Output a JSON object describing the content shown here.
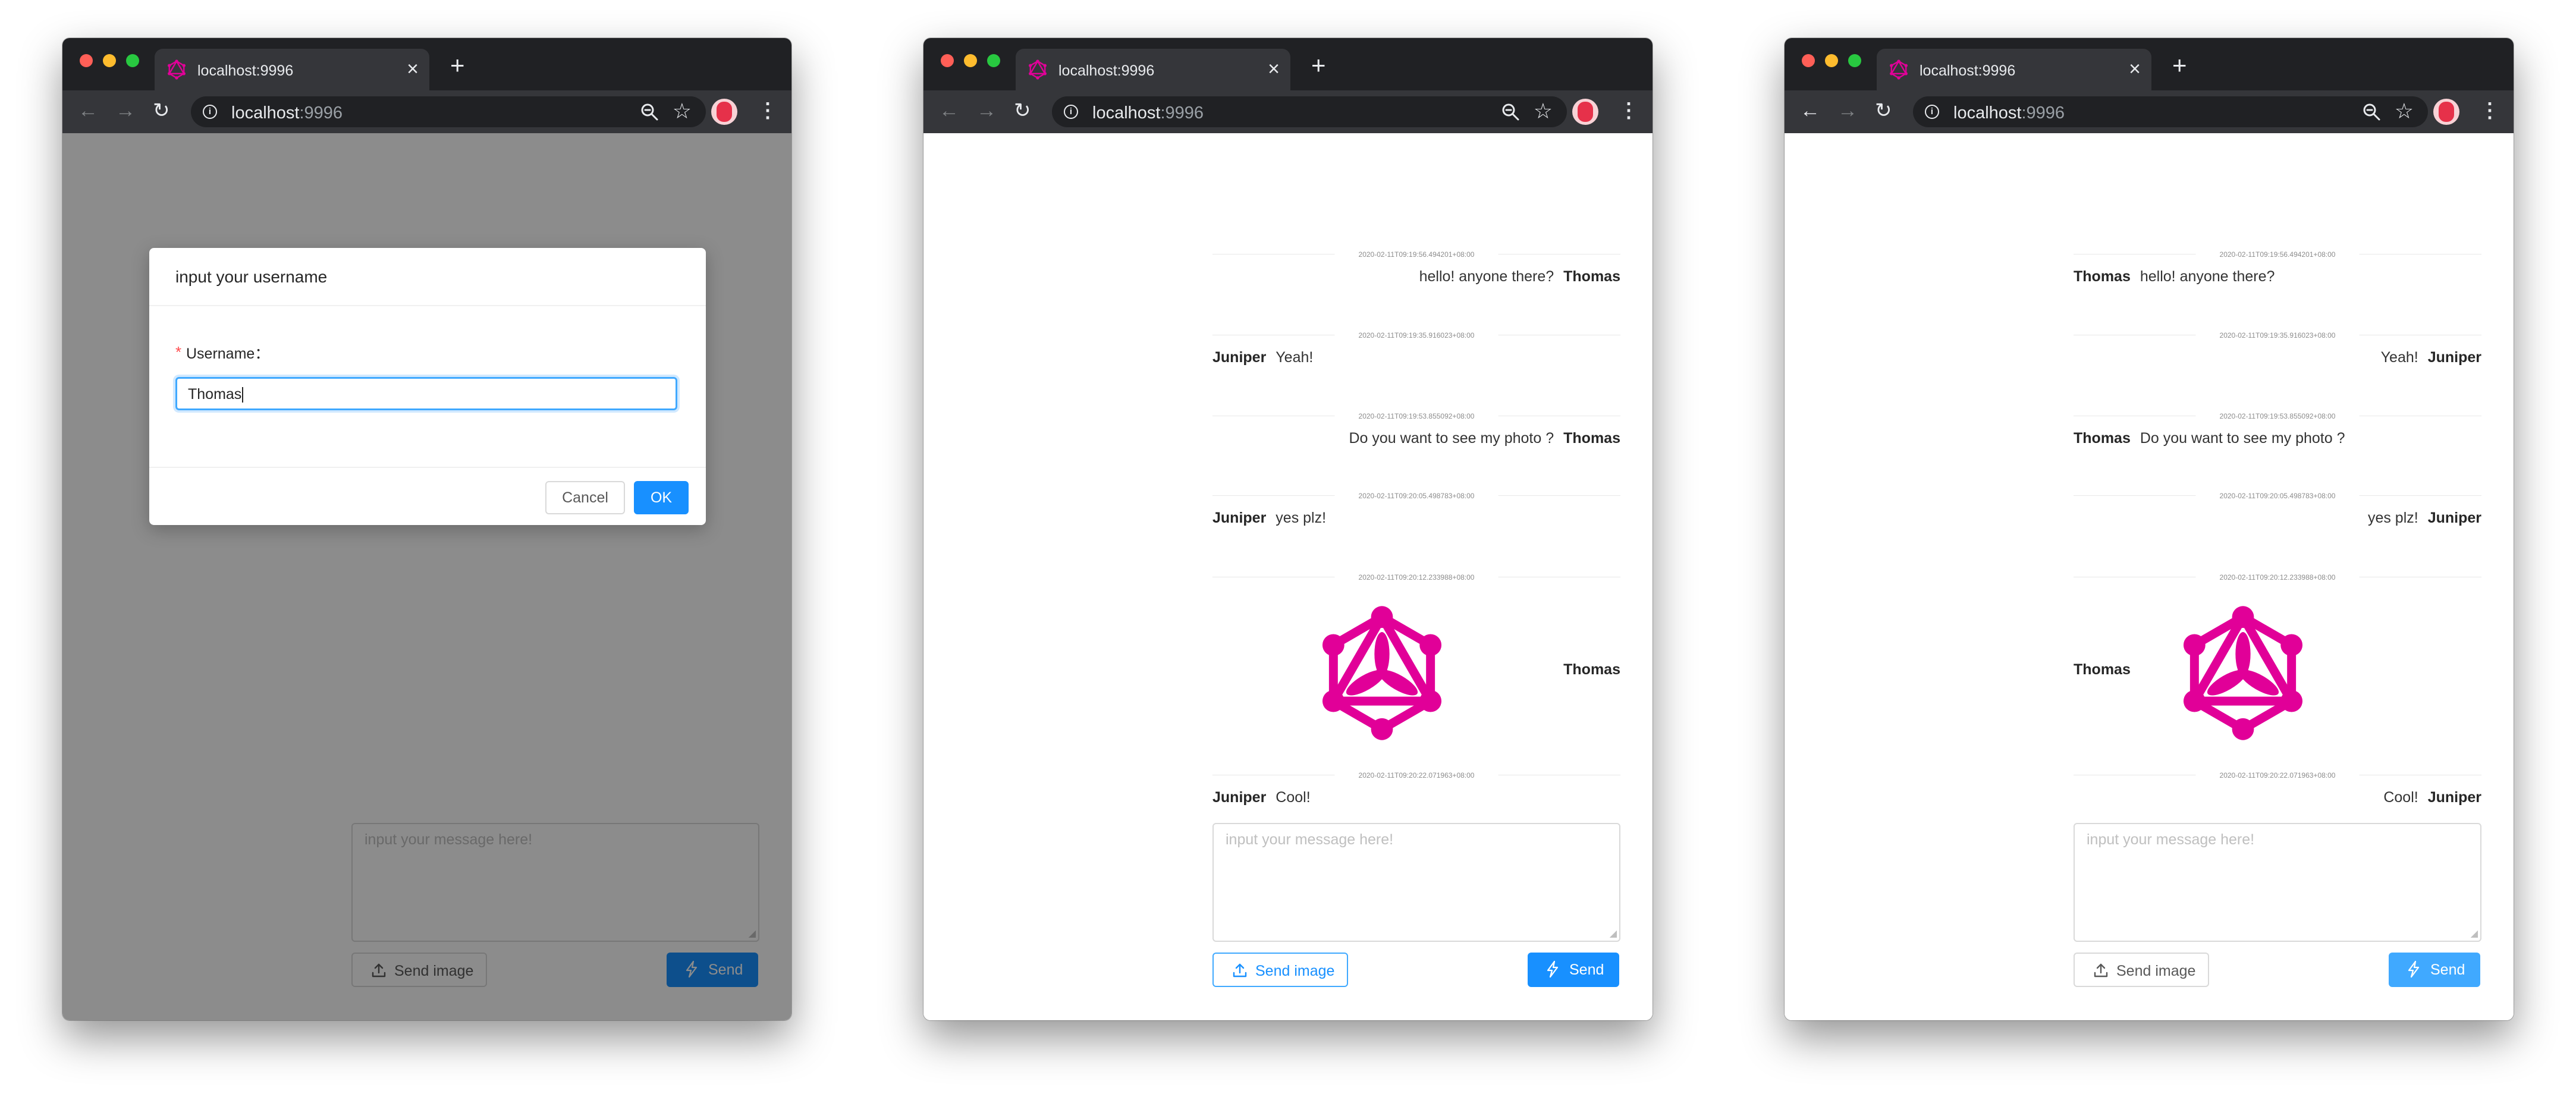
{
  "browser": {
    "tab_title": "localhost:9996",
    "url_host": "localhost",
    "url_port": ":9996",
    "icons": [
      "graphql-favicon",
      "close-icon",
      "plus-icon",
      "back-arrow-icon",
      "forward-arrow-icon",
      "reload-icon",
      "info-icon",
      "zoom-icon",
      "star-icon",
      "avatar",
      "more-vert-icon"
    ]
  },
  "modal": {
    "title": "input your username",
    "required_mark": "*",
    "field_label": "Username：",
    "field_value": "Thomas",
    "cancel_label": "Cancel",
    "ok_label": "OK"
  },
  "composer": {
    "placeholder": "input your message here!",
    "send_image_label": "Send image",
    "send_label": "Send",
    "resize_grip": "◢"
  },
  "messages": [
    {
      "timestamp": "2020-02-11T09:19:56.494201+08:00",
      "author": "Thomas",
      "text": "hello! anyone there?"
    },
    {
      "timestamp": "2020-02-11T09:19:35.916023+08:00",
      "author": "Juniper",
      "text": "Yeah!"
    },
    {
      "timestamp": "2020-02-11T09:19:53.855092+08:00",
      "author": "Thomas",
      "text": "Do you want to see my photo ?"
    },
    {
      "timestamp": "2020-02-11T09:20:05.498783+08:00",
      "author": "Juniper",
      "text": "yes plz!"
    },
    {
      "timestamp": "2020-02-11T09:20:12.233988+08:00",
      "author": "Thomas",
      "image": "graphql-logo"
    },
    {
      "timestamp": "2020-02-11T09:20:22.071963+08:00",
      "author": "Juniper",
      "text": "Cool!"
    }
  ],
  "colors": {
    "accent": "#1890ff",
    "graphql_pink": "#e10098",
    "chrome_dark": "#202124",
    "chrome_tab": "#35363a",
    "overlay": "rgba(0,0,0,0.45)"
  }
}
